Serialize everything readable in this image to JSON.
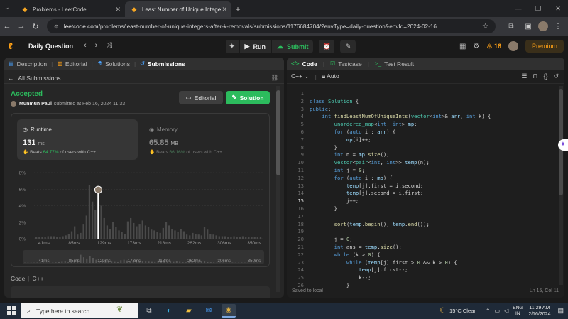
{
  "browser": {
    "tabs": [
      {
        "title": "Problems - LeetCode",
        "active": false
      },
      {
        "title": "Least Number of Unique Intege",
        "active": true
      }
    ],
    "url_host": "leetcode.com",
    "url_path": "/problems/least-number-of-unique-integers-after-k-removals/submissions/1176684704/?envType=daily-question&envId=2024-02-16"
  },
  "header": {
    "title": "Daily Question",
    "run_label": "Run",
    "submit_label": "Submit",
    "streak": "16",
    "premium_label": "Premium"
  },
  "left": {
    "tabs": [
      {
        "label": "Description",
        "icon": "description-icon"
      },
      {
        "label": "Editorial",
        "icon": "book-icon"
      },
      {
        "label": "Solutions",
        "icon": "flask-icon"
      },
      {
        "label": "Submissions",
        "icon": "history-icon"
      }
    ],
    "all_submissions": "All Submissions",
    "status": "Accepted",
    "user": "Munmun Paul",
    "submitted_text": "submitted at Feb 16, 2024 11:33",
    "editorial_btn": "Editorial",
    "solution_btn": "Solution",
    "runtime": {
      "title": "Runtime",
      "value": "131",
      "unit": "ms",
      "beats_prefix": "Beats",
      "beats_pct": "64.77%",
      "beats_suffix": "of users with C++"
    },
    "memory": {
      "title": "Memory",
      "value": "65.85",
      "unit": "MB",
      "beats_prefix": "Beats",
      "beats_pct": "66.16%",
      "beats_suffix": "of users with C++"
    },
    "code_label": "Code",
    "code_lang": "C++"
  },
  "chart_data": {
    "type": "bar",
    "y_ticks": [
      "8%",
      "6%",
      "4%",
      "2%",
      "0%"
    ],
    "ylim": [
      0,
      8
    ],
    "x_ticks": [
      "41ms",
      "85ms",
      "129ms",
      "173ms",
      "218ms",
      "262ms",
      "306ms",
      "350ms"
    ],
    "values": [
      0.2,
      0.2,
      0.2,
      0.2,
      0.3,
      0.3,
      0.3,
      0.2,
      0.2,
      0.3,
      0.4,
      0.6,
      0.9,
      1.5,
      0.5,
      0.7,
      1.8,
      2.8,
      6.5,
      4.5,
      3.5,
      5.5,
      4.0,
      2.5,
      1.6,
      1.2,
      2.0,
      1.4,
      1.0,
      0.8,
      0.6,
      2.1,
      2.5,
      1.9,
      1.5,
      1.8,
      2.2,
      1.6,
      1.4,
      1.1,
      1.0,
      0.8,
      0.7,
      1.3,
      2.0,
      1.6,
      1.2,
      1.0,
      0.8,
      1.2,
      0.9,
      0.5,
      0.4,
      0.7,
      0.6,
      0.5,
      0.4,
      1.4,
      1.1,
      0.6,
      0.5,
      0.4,
      0.3,
      0.3,
      0.3,
      0.2,
      0.2,
      0.3,
      0.2,
      0.2,
      0.3,
      0.2,
      0.2,
      0.2,
      0.2,
      0.2,
      0.2
    ],
    "highlight_index": 21
  },
  "right": {
    "tabs": [
      {
        "label": "Code",
        "icon": "code-icon"
      },
      {
        "label": "Testcase",
        "icon": "checkbox-icon"
      },
      {
        "label": "Test Result",
        "icon": "terminal-icon"
      }
    ],
    "lang": "C++",
    "mode": "Auto",
    "saved": "Saved to local",
    "cursor": "Ln 15, Col 11",
    "current_line": 15,
    "code_lines": [
      "",
      "class Solution {",
      "public:",
      "    int findLeastNumOfUniqueInts(vector<int>& arr, int k) {",
      "        unordered_map<int, int> mp;",
      "        for (auto i : arr) {",
      "            mp[i]++;",
      "        }",
      "        int n = mp.size();",
      "        vector<pair<int, int>> temp(n);",
      "        int j = 0;",
      "        for (auto i : mp) {",
      "            temp[j].first = i.second;",
      "            temp[j].second = i.first;",
      "            j++;",
      "        }",
      "",
      "        sort(temp.begin(), temp.end());",
      "",
      "        j = 0;",
      "        int ans = temp.size();",
      "        while (k > 0) {",
      "            while (temp[j].first > 0 && k > 0) {",
      "                temp[j].first--;",
      "                k--;",
      "            }"
    ]
  },
  "taskbar": {
    "search_placeholder": "Type here to search",
    "weather": "15°C  Clear",
    "lang_top": "ENG",
    "lang_bottom": "IN",
    "time": "11:29 AM",
    "date": "2/16/2024"
  }
}
